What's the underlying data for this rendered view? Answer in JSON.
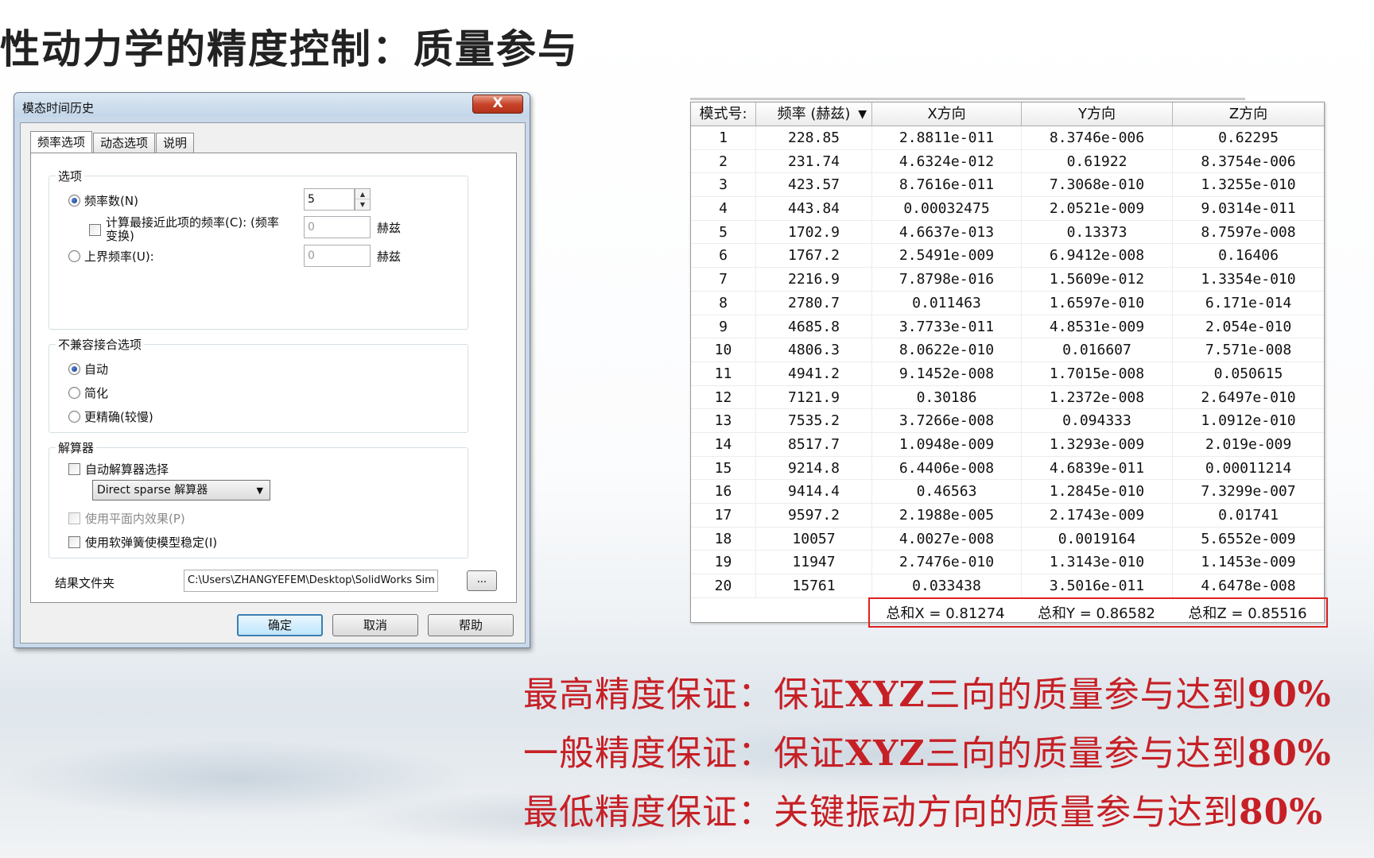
{
  "slide": {
    "title": "性动力学的精度控制：质量参与"
  },
  "dialog": {
    "title": "模态时间历史",
    "close_label": "X",
    "tabs": [
      {
        "label": "频率选项",
        "active": true
      },
      {
        "label": "动态选项",
        "active": false
      },
      {
        "label": "说明",
        "active": false
      }
    ],
    "options_group": {
      "title": "选项",
      "freq_count_label": "频率数(N)",
      "freq_count_value": "5",
      "nearest_freq_label_1": "计算最接近此项的频率(C): (频率",
      "nearest_freq_label_2": "变换)",
      "nearest_freq_value": "0",
      "upper_freq_label": "上界频率(U):",
      "upper_freq_value": "0",
      "unit_hz": "赫兹"
    },
    "incompatible_group": {
      "title": "不兼容接合选项",
      "auto_label": "自动",
      "simplified_label": "简化",
      "accurate_label": "更精确(较慢)"
    },
    "solver_group": {
      "title": "解算器",
      "auto_solver_label": "自动解算器选择",
      "solver_selected": "Direct sparse 解算器",
      "inplane_label": "使用平面内效果(P)",
      "soft_spring_label": "使用软弹簧使模型稳定(I)"
    },
    "results_folder_label": "结果文件夹",
    "results_folder_value": "C:\\Users\\ZHANGYEFEM\\Desktop\\SolidWorks Sim",
    "browse_label": "...",
    "ok_label": "确定",
    "cancel_label": "取消",
    "help_label": "帮助"
  },
  "mass_table": {
    "headers": [
      "模式号:",
      "频率 (赫兹)",
      "X方向",
      "Y方向",
      "Z方向"
    ],
    "sort_indicator": "▼",
    "rows": [
      [
        "1",
        "228.85",
        "2.8811e-011",
        "8.3746e-006",
        "0.62295"
      ],
      [
        "2",
        "231.74",
        "4.6324e-012",
        "0.61922",
        "8.3754e-006"
      ],
      [
        "3",
        "423.57",
        "8.7616e-011",
        "7.3068e-010",
        "1.3255e-010"
      ],
      [
        "4",
        "443.84",
        "0.00032475",
        "2.0521e-009",
        "9.0314e-011"
      ],
      [
        "5",
        "1702.9",
        "4.6637e-013",
        "0.13373",
        "8.7597e-008"
      ],
      [
        "6",
        "1767.2",
        "2.5491e-009",
        "6.9412e-008",
        "0.16406"
      ],
      [
        "7",
        "2216.9",
        "7.8798e-016",
        "1.5609e-012",
        "1.3354e-010"
      ],
      [
        "8",
        "2780.7",
        "0.011463",
        "1.6597e-010",
        "6.171e-014"
      ],
      [
        "9",
        "4685.8",
        "3.7733e-011",
        "4.8531e-009",
        "2.054e-010"
      ],
      [
        "10",
        "4806.3",
        "8.0622e-010",
        "0.016607",
        "7.571e-008"
      ],
      [
        "11",
        "4941.2",
        "9.1452e-008",
        "1.7015e-008",
        "0.050615"
      ],
      [
        "12",
        "7121.9",
        "0.30186",
        "1.2372e-008",
        "2.6497e-010"
      ],
      [
        "13",
        "7535.2",
        "3.7266e-008",
        "0.094333",
        "1.0912e-010"
      ],
      [
        "14",
        "8517.7",
        "1.0948e-009",
        "1.3293e-009",
        "2.019e-009"
      ],
      [
        "15",
        "9214.8",
        "6.4406e-008",
        "4.6839e-011",
        "0.00011214"
      ],
      [
        "16",
        "9414.4",
        "0.46563",
        "1.2845e-010",
        "7.3299e-007"
      ],
      [
        "17",
        "9597.2",
        "2.1988e-005",
        "2.1743e-009",
        "0.01741"
      ],
      [
        "18",
        "10057",
        "4.0027e-008",
        "0.0019164",
        "5.6552e-009"
      ],
      [
        "19",
        "11947",
        "2.7476e-010",
        "1.3143e-010",
        "1.1453e-009"
      ],
      [
        "20",
        "15761",
        "0.033438",
        "3.5016e-011",
        "4.6478e-008"
      ]
    ],
    "sums": [
      "总和X = 0.81274",
      "总和Y = 0.86582",
      "总和Z = 0.85516"
    ],
    "highlight_color": "#e02020"
  },
  "notes": [
    {
      "prefix": "最高精度保证：保证",
      "bold": "XYZ",
      "middle": "三向的质量参与达到",
      "value": "90%"
    },
    {
      "prefix": "一般精度保证：保证",
      "bold": "XYZ",
      "middle": "三向的质量参与达到",
      "value": "80%"
    },
    {
      "prefix": "最低精度保证：关键振动方向的质量参与达到",
      "bold": "",
      "middle": "",
      "value": "80%"
    }
  ],
  "colors": {
    "note_red": "#c62026"
  }
}
